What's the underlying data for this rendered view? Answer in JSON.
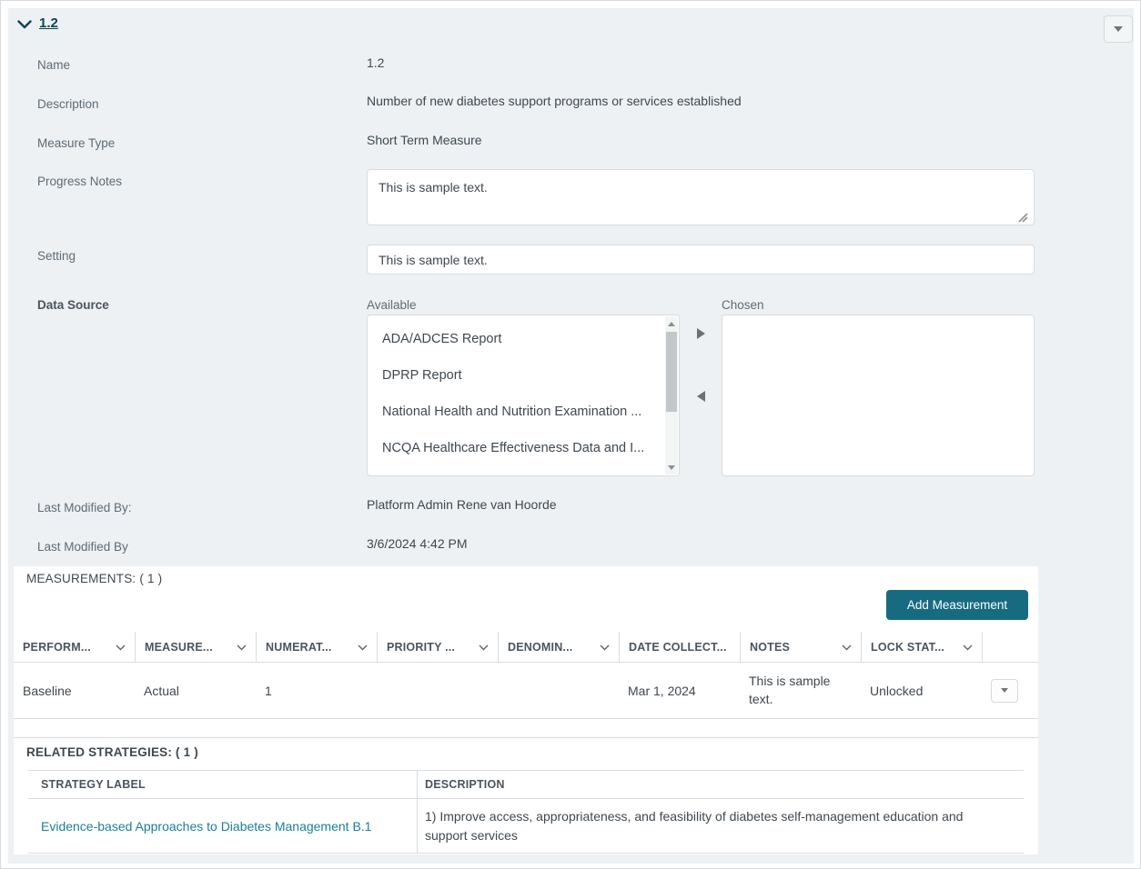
{
  "header": {
    "title": "1.2"
  },
  "form": {
    "name_label": "Name",
    "name_value": "1.2",
    "description_label": "Description",
    "description_value": "Number of new diabetes support programs or services established",
    "measure_type_label": "Measure Type",
    "measure_type_value": "Short Term Measure",
    "progress_notes_label": "Progress Notes",
    "progress_notes_value": "This is sample text.",
    "setting_label": "Setting",
    "setting_value": "This is sample text.",
    "data_source_label": "Data Source",
    "data_source": {
      "available_label": "Available",
      "chosen_label": "Chosen",
      "available_options": [
        "ADA/ADCES Report",
        "DPRP Report",
        "National Health and Nutrition Examination ...",
        "NCQA Healthcare Effectiveness Data and I..."
      ],
      "chosen_options": []
    },
    "last_modified_by_label": "Last Modified By:",
    "last_modified_by_value": "Platform Admin Rene van Hoorde",
    "last_modified_date_label": "Last Modified By",
    "last_modified_date_value": "3/6/2024 4:42 PM"
  },
  "measurements": {
    "section_title": "MEASUREMENTS: ( 1 )",
    "add_button_label": "Add Measurement",
    "columns": [
      "PERFORM...",
      "MEASURE...",
      "NUMERAT...",
      "PRIORITY ...",
      "DENOMIN...",
      "DATE COLLECT...",
      "NOTES",
      "LOCK STAT..."
    ],
    "rows": [
      {
        "performance": "Baseline",
        "measure": "Actual",
        "numerator": "1",
        "priority": "",
        "denominator": "",
        "date_collected": "Mar 1, 2024",
        "notes": "This is sample text.",
        "lock_status": "Unlocked"
      }
    ]
  },
  "related_strategies": {
    "section_title": "RELATED STRATEGIES: ( 1 )",
    "columns": {
      "strategy_label": "STRATEGY LABEL",
      "description": "DESCRIPTION"
    },
    "rows": [
      {
        "strategy_label": "Evidence-based Approaches to Diabetes Management B.1",
        "description": "1) Improve access, appropriateness, and feasibility of diabetes self-management education and support services"
      }
    ]
  },
  "colors": {
    "page_bg": "#edf1f3",
    "accent_teal": "#176b80",
    "title_teal": "#0d4554",
    "link_teal": "#1b7f99"
  }
}
